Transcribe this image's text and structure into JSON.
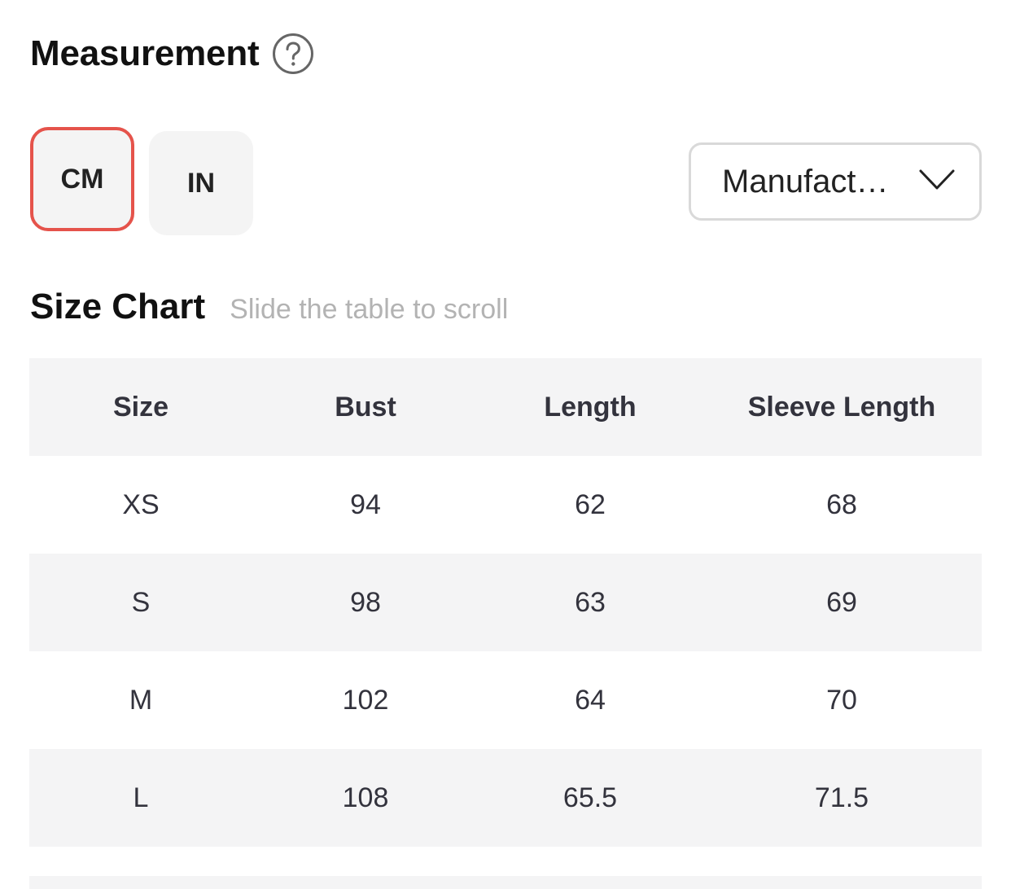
{
  "measurement": {
    "title": "Measurement",
    "help_icon": "question-circle-icon"
  },
  "units": {
    "options": [
      "CM",
      "IN"
    ],
    "selected": "CM",
    "accent_color": "#e5534b"
  },
  "dropdown": {
    "value": "Manufact…",
    "icon": "chevron-down-icon"
  },
  "size_chart": {
    "title": "Size Chart",
    "hint": "Slide the table to scroll",
    "columns": [
      "Size",
      "Bust",
      "Length",
      "Sleeve Length"
    ],
    "rows": [
      [
        "XS",
        "94",
        "62",
        "68"
      ],
      [
        "S",
        "98",
        "63",
        "69"
      ],
      [
        "M",
        "102",
        "64",
        "70"
      ],
      [
        "L",
        "108",
        "65.5",
        "71.5"
      ]
    ]
  }
}
